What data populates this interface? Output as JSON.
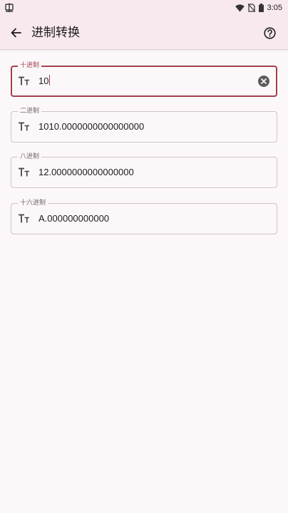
{
  "status_bar": {
    "time": "3:05",
    "icons": [
      "app-notification-icon",
      "wifi-icon",
      "no-sim-icon",
      "battery-icon"
    ]
  },
  "app_bar": {
    "title": "进制转换",
    "icons": [
      "back-arrow-icon",
      "help-icon"
    ]
  },
  "fields": [
    {
      "label": "十进制",
      "value": "10",
      "focused": true,
      "icon": "text-size-icon"
    },
    {
      "label": "二进制",
      "value": "1010.0000000000000000",
      "focused": false,
      "icon": "text-size-icon"
    },
    {
      "label": "八进制",
      "value": "12.0000000000000000",
      "focused": false,
      "icon": "text-size-icon"
    },
    {
      "label": "十六进制",
      "value": "A.000000000000",
      "focused": false,
      "icon": "text-size-icon"
    }
  ],
  "colors": {
    "accent": "#a3404c",
    "app_bar_bg": "#f7e9ee",
    "page_bg": "#fcf8fa",
    "outline": "#cfc4c8"
  }
}
